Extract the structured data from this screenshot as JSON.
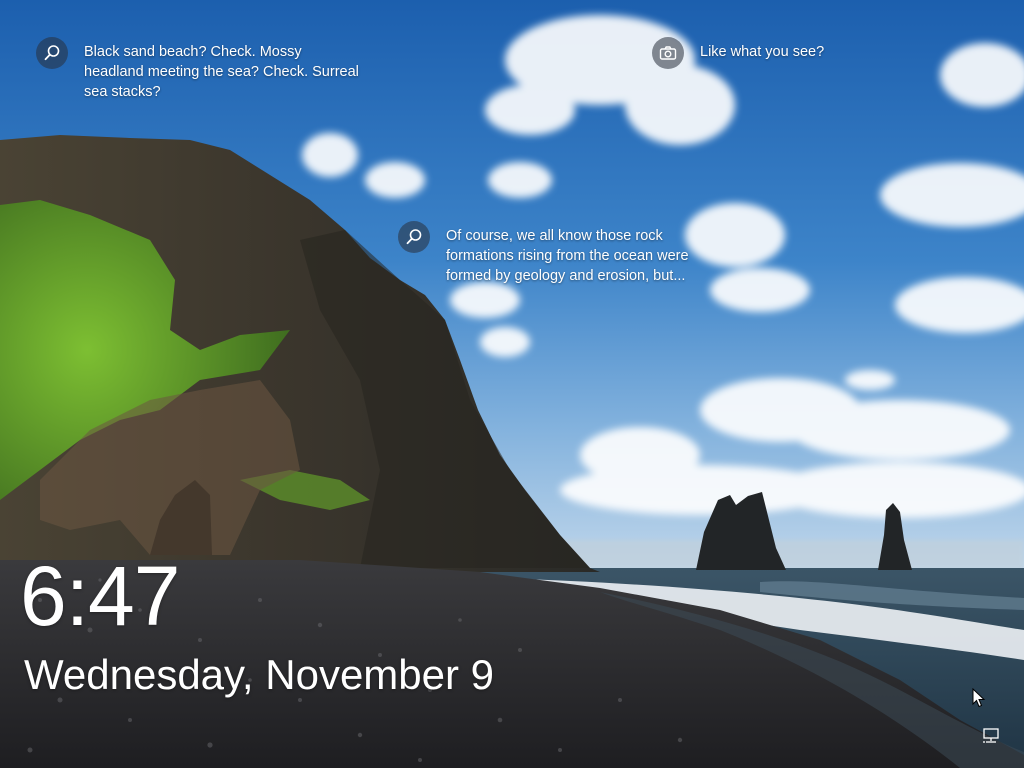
{
  "lock_screen": {
    "time": "6:47",
    "date": "Wednesday, November 9"
  },
  "spotlight": {
    "hotspots": [
      {
        "icon": "search-icon",
        "text": "Black sand beach? Check. Mossy\nheadland meeting the sea? Check. Surreal\nsea stacks?"
      },
      {
        "icon": "camera-icon",
        "text": "Like what you see?"
      },
      {
        "icon": "search-icon",
        "text": "Of course, we all know those rock\nformations rising from the ocean were\nformed by geology and erosion, but..."
      }
    ]
  },
  "status_icons": [
    {
      "icon": "network-icon"
    }
  ],
  "colors": {
    "sky_top": "#1c5fae",
    "sky_bottom": "#a9c9e6",
    "cliff": "#3b3a33",
    "moss": "#6aa82c",
    "sea": "#2e4455",
    "beach": "#2b2b2e",
    "text": "#ffffff"
  }
}
